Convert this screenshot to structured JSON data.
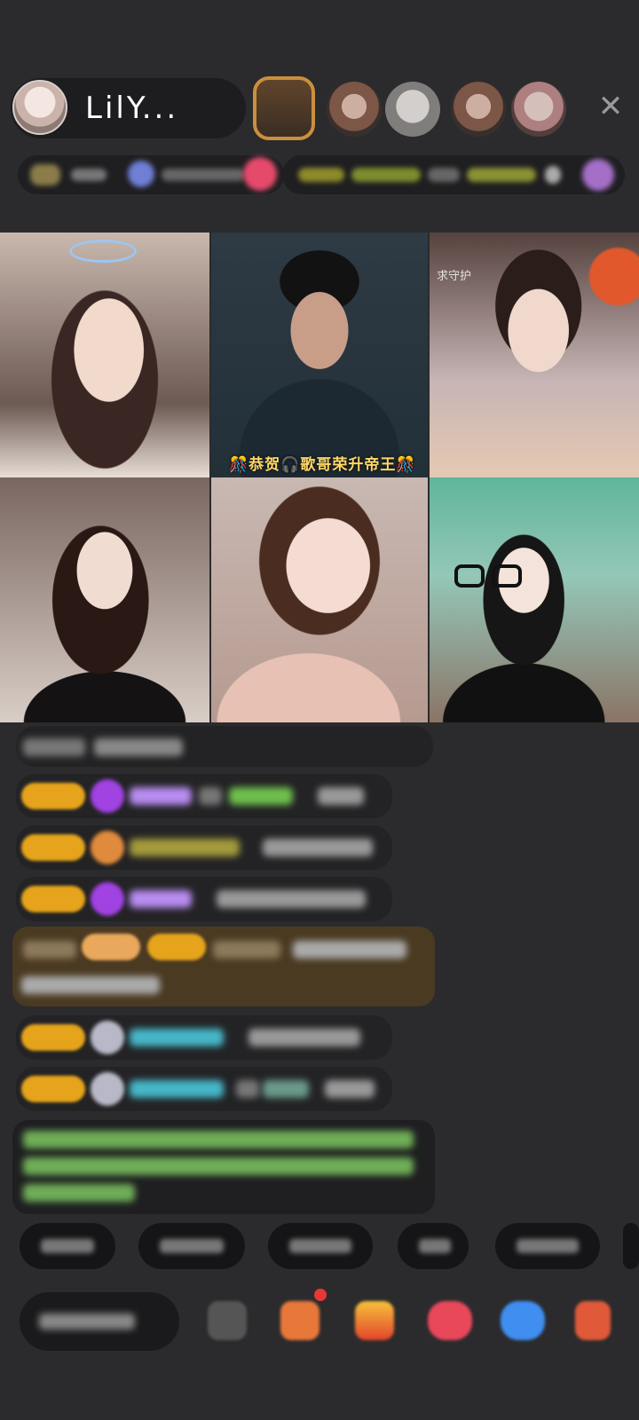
{
  "header": {
    "host_name": "LilY...",
    "close_icon": "close-icon"
  },
  "video_grid": {
    "tiles": [
      {
        "id": "tile-1"
      },
      {
        "id": "tile-2",
        "caption": "🎊恭贺🎧歌哥荣升帝王🎊"
      },
      {
        "id": "tile-3",
        "note": "求守护"
      },
      {
        "id": "tile-4"
      },
      {
        "id": "tile-5"
      },
      {
        "id": "tile-6"
      }
    ]
  },
  "colors": {
    "background": "#2b2b2d",
    "level_badge": "#e5a41b",
    "gift_highlight": "#4a3a22",
    "username_purple": "#b88cf0",
    "username_teal": "#46b7c8",
    "username_green": "#6fbf4c",
    "system_green": "#7bd05a"
  }
}
